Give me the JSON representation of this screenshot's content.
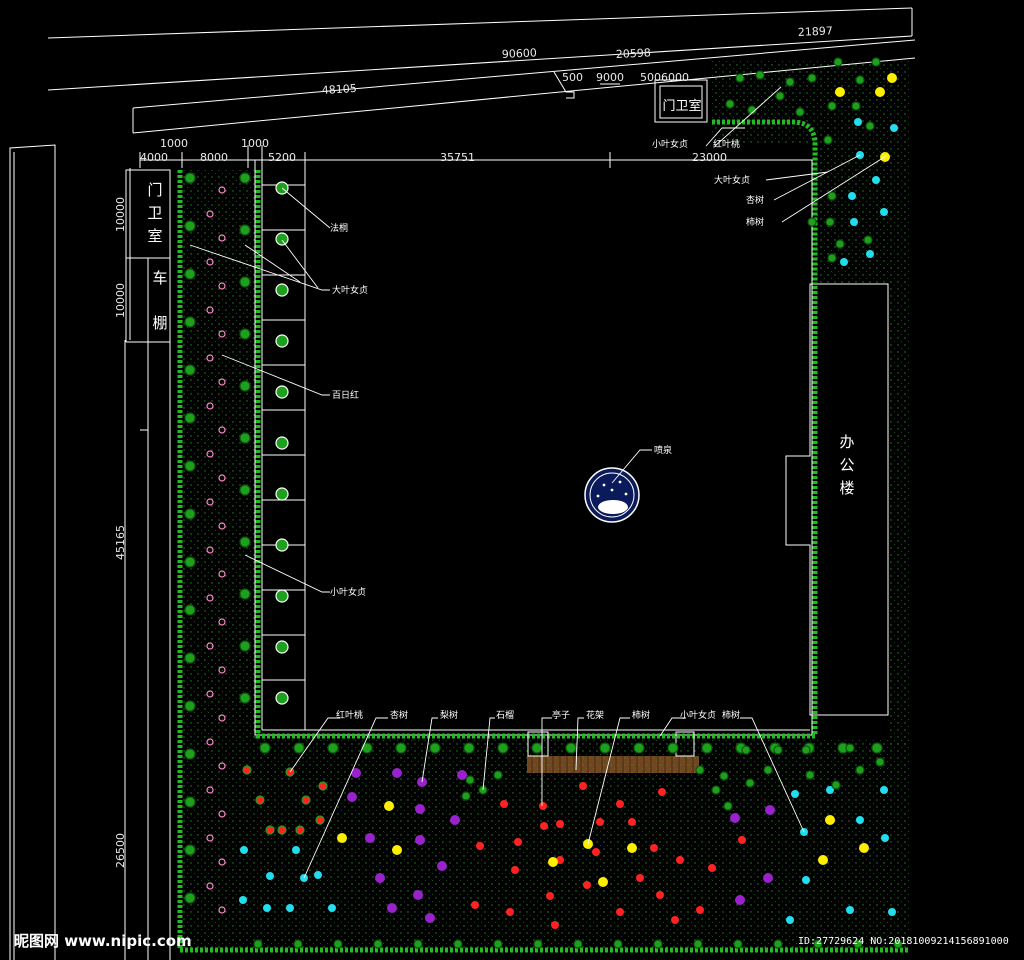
{
  "dimensions": {
    "top_road": [
      "90600",
      "20598",
      "21897",
      "48105"
    ],
    "gate_area": [
      "500",
      "9000",
      "5006000"
    ],
    "left_top": [
      "1000",
      "1000",
      "4000",
      "8000",
      "5200",
      "35751",
      "23000"
    ],
    "left_side": [
      "10000",
      "10000",
      "45165",
      "26500"
    ]
  },
  "buildings": {
    "gate_house_left": "门卫室",
    "carport": "车棚",
    "gate_house_top": "门卫室",
    "office": "办公楼"
  },
  "labels": {
    "fountain": "喷泉",
    "plane_tree": "法桐",
    "ligustrum_large": "大叶女贞",
    "crape_myrtle": "百日红",
    "ligustrum_small": "小叶女贞",
    "red_peach_top": "红叶桃",
    "small_ligustrum_top": "小叶女贞",
    "large_ligustrum_right": "大叶女贞",
    "apricot_right": "杏树",
    "persimmon_right": "柿树",
    "bottom": [
      "红叶桃",
      "杏树",
      "梨树",
      "石榴",
      "亭子",
      "花架",
      "柿树",
      "小叶女贞",
      "柿树"
    ]
  },
  "watermark": {
    "site": "昵图网 www.nipic.com",
    "id": "ID:27729624 NO:20181009214156891000"
  },
  "colors": {
    "background": "#000000",
    "lines": "#ffffff",
    "hedge": "#22bb22",
    "tree_green": "#1ea01e",
    "flower_pink": "#ff88cc",
    "tree_red": "#ff2222",
    "tree_purple": "#9922cc",
    "tree_yellow": "#ffee00",
    "tree_cyan": "#22ddee",
    "pergola": "#8b5a2b",
    "fountain": "#0a1a5a"
  }
}
